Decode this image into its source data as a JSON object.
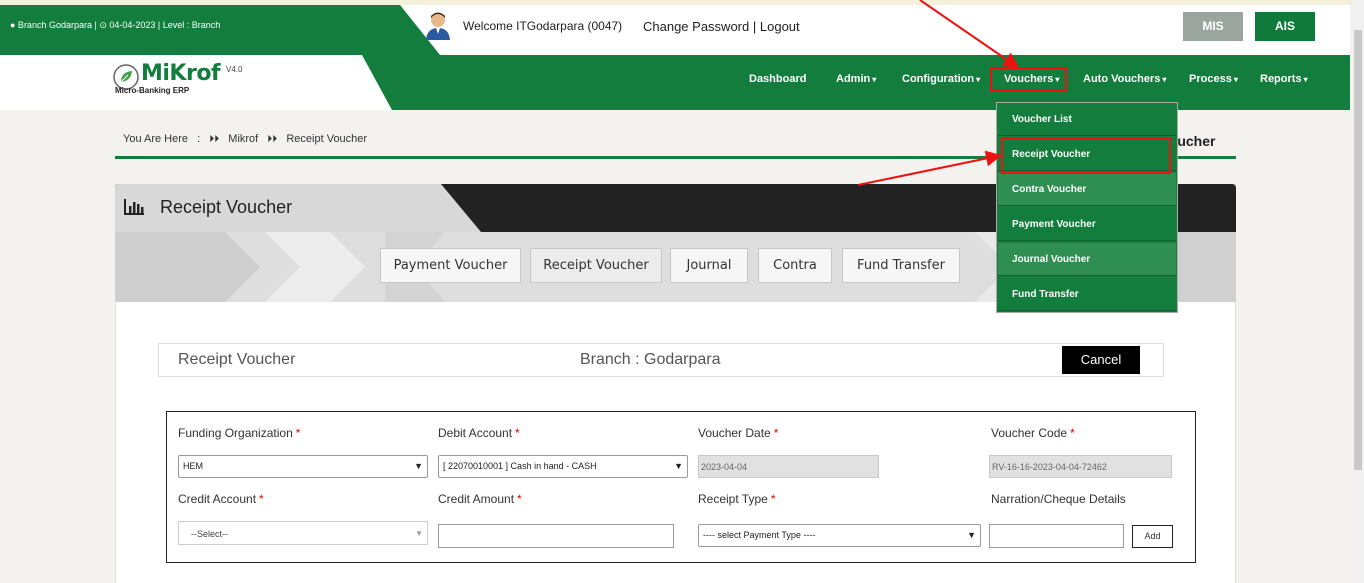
{
  "topbar": {
    "branch_info": "● Branch Godarpara |  ⊙ 04-04-2023 | Level : Branch",
    "welcome": "Welcome ITGodarpara (0047)",
    "change_password": "Change Password",
    "separator": "|",
    "logout": "Logout",
    "mis_label": "MIS",
    "ais_label": "AIS"
  },
  "logo": {
    "name": "MiKrof",
    "version": "V4.0",
    "subtitle": "Micro-Banking ERP"
  },
  "nav": {
    "items": [
      {
        "label": "Dashboard",
        "caret": ""
      },
      {
        "label": "Admin",
        "caret": "▾"
      },
      {
        "label": "Configuration",
        "caret": "▾"
      },
      {
        "label": "Vouchers",
        "caret": "▾"
      },
      {
        "label": "Auto Vouchers",
        "caret": "▾"
      },
      {
        "label": "Process",
        "caret": "▾"
      },
      {
        "label": "Reports",
        "caret": "▾"
      }
    ]
  },
  "vouchers_menu": {
    "items": [
      "Voucher List",
      "Receipt Voucher",
      "Contra Voucher",
      "Payment Voucher",
      "Journal Voucher",
      "Fund Transfer"
    ]
  },
  "breadcrumb": {
    "prefix": "You Are Here",
    "colon": ":",
    "sep": "⏵⏵",
    "items": [
      "Mikrof",
      "Receipt Voucher"
    ]
  },
  "page_title_right": "Receipt Voucher",
  "panel": {
    "title": "Receipt Voucher",
    "tabs": [
      "Payment Voucher",
      "Receipt Voucher",
      "Journal",
      "Contra",
      "Fund Transfer"
    ]
  },
  "info_bar": {
    "left": "Receipt Voucher",
    "branch": "Branch : Godarpara",
    "cancel": "Cancel"
  },
  "form": {
    "required_mark": "*",
    "funding_org_label": "Funding Organization",
    "funding_org_value": "HEM",
    "debit_account_label": "Debit Account",
    "debit_account_value": "[ 22070010001 ] Cash in hand - CASH",
    "voucher_date_label": "Voucher Date",
    "voucher_date_value": "2023-04-04",
    "voucher_code_label": "Voucher Code",
    "voucher_code_value": "RV-16-16-2023-04-04-72462",
    "credit_account_label": "Credit Account",
    "credit_account_value": "--Select--",
    "credit_amount_label": "Credit Amount",
    "credit_amount_value": "",
    "receipt_type_label": "Receipt Type",
    "receipt_type_value": "---- select Payment Type ----",
    "narration_label": "Narration/Cheque Details",
    "narration_value": "",
    "add_label": "Add"
  }
}
